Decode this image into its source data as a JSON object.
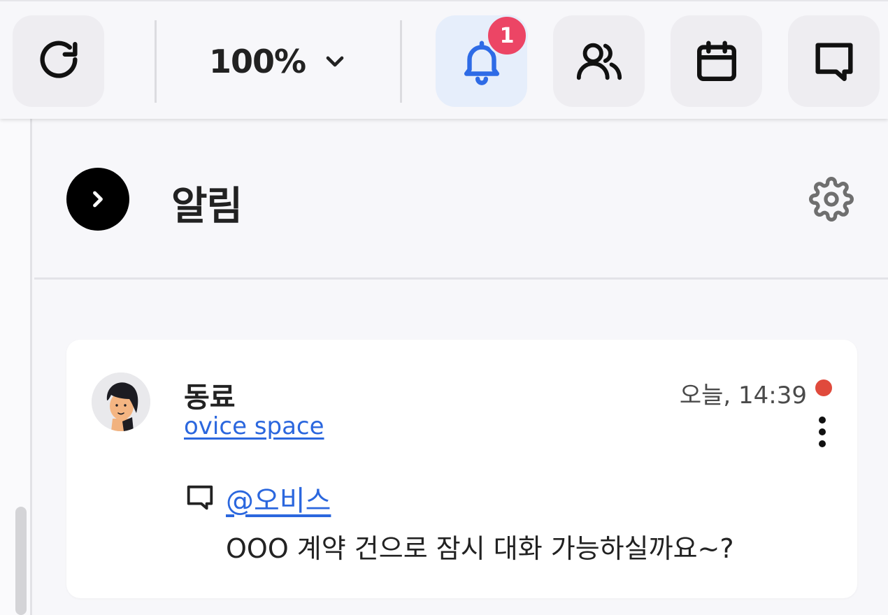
{
  "toolbar": {
    "refresh_icon": "refresh-icon",
    "zoom_value": "100%",
    "zoom_icon": "chevron-down-icon",
    "notifications_icon": "bell-icon",
    "notification_count": "1",
    "members_icon": "users-icon",
    "calendar_icon": "calendar-icon",
    "chat_icon": "chat-bubble-icon",
    "accent_color": "#2e6be6",
    "badge_color": "#ec4565"
  },
  "panel": {
    "title": "알림",
    "collapse_icon": "chevron-right-icon",
    "settings_icon": "gear-icon"
  },
  "notification": {
    "sender": "동료",
    "space": "ovice space",
    "time": "오늘, 14:39",
    "unread": true,
    "unread_color": "#e04a3c",
    "more_icon": "more-vertical-icon",
    "type_icon": "comment-icon",
    "mention": "@오비스",
    "message": "OOO 계약 건으로 잠시 대화 가능하실까요~?"
  }
}
